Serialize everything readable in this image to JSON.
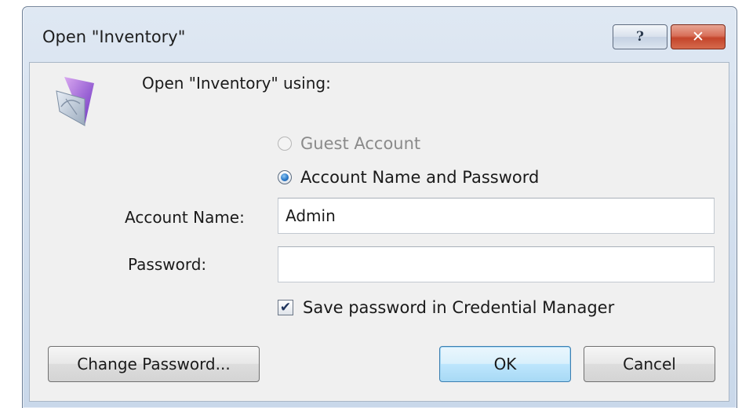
{
  "window": {
    "title": "Open \"Inventory\"",
    "help_glyph": "?",
    "close_glyph": "✕"
  },
  "dialog": {
    "prompt": "Open \"Inventory\" using:",
    "app_icon": "filemaker-app-icon",
    "options": {
      "guest": {
        "label": "Guest Account",
        "selected": false,
        "enabled": false
      },
      "account": {
        "label": "Account Name and Password",
        "selected": true,
        "enabled": true
      }
    },
    "account_name": {
      "label": "Account Name:",
      "value": "Admin"
    },
    "password": {
      "label": "Password:",
      "value": ""
    },
    "save_password": {
      "label": "Save password in Credential Manager",
      "checked": true,
      "check_glyph": "✔"
    }
  },
  "buttons": {
    "change_password": "Change Password...",
    "ok": "OK",
    "cancel": "Cancel"
  },
  "colors": {
    "title_bar": "#c9d8ea",
    "client_bg": "#f0f0f0",
    "close_button": "#c4452b",
    "default_button_border": "#3c7fb1",
    "disabled_text": "#8a8a8a"
  }
}
